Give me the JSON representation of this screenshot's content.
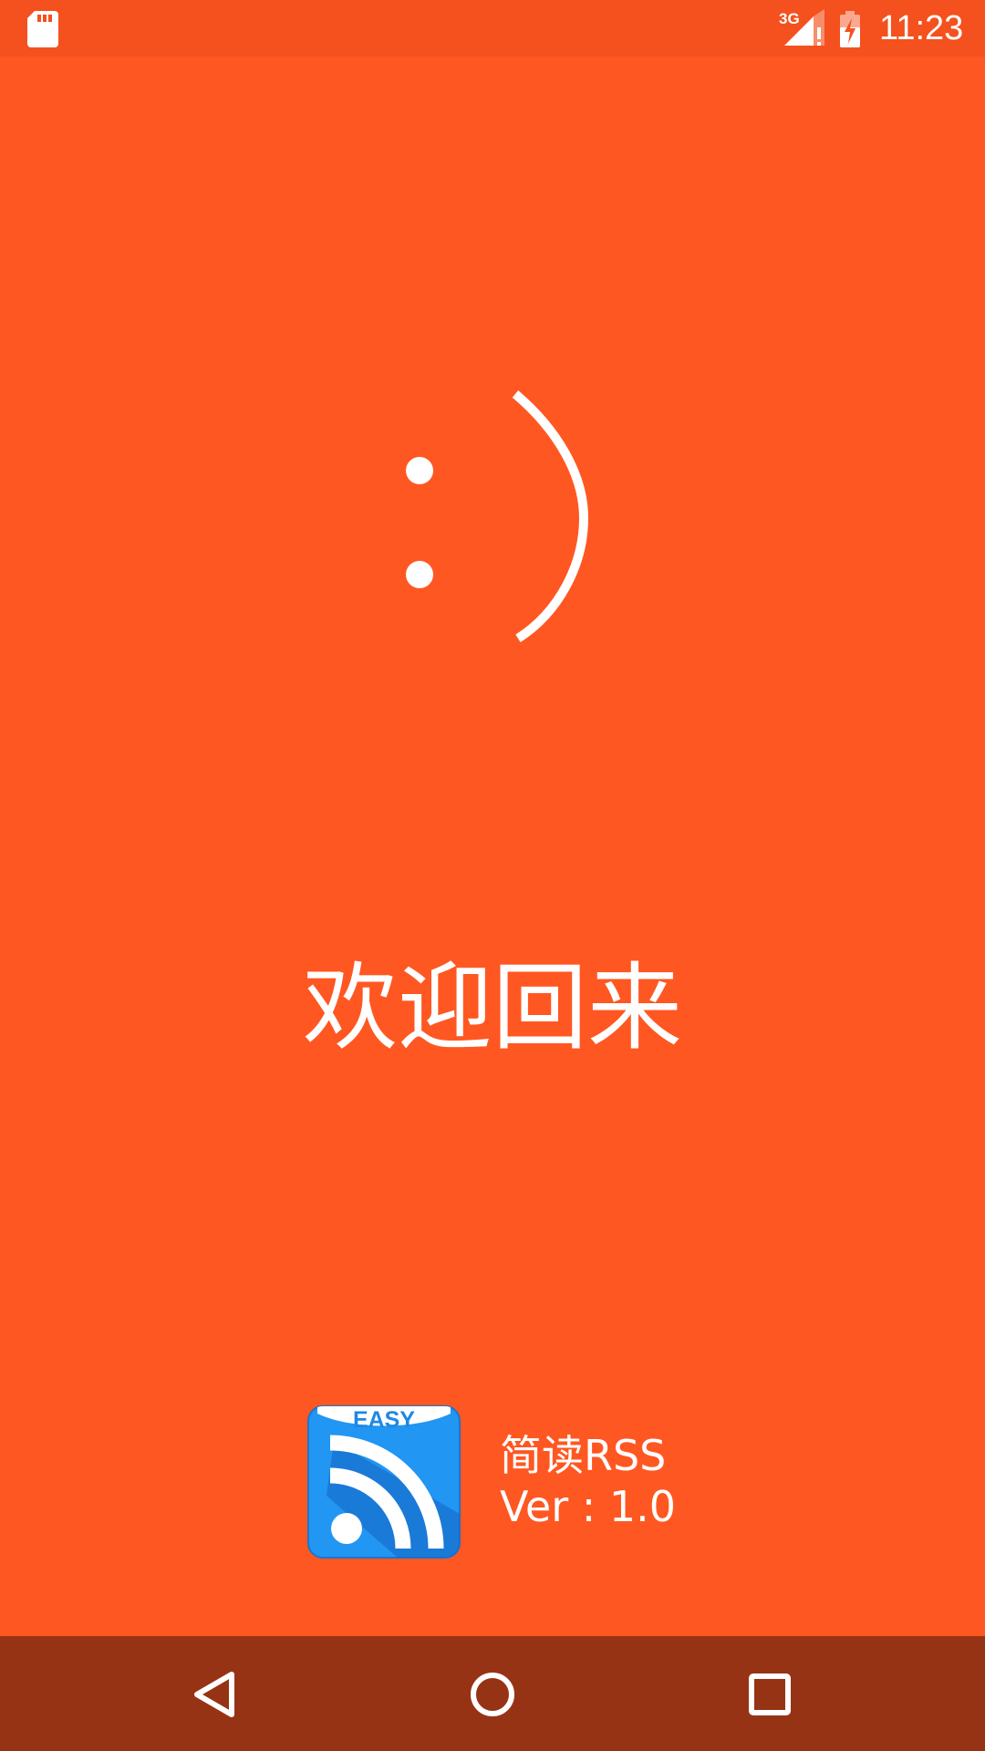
{
  "status_bar": {
    "network_label": "3G",
    "time": "11:23"
  },
  "splash": {
    "emoticon": ":)",
    "welcome_text": "欢迎回来"
  },
  "app": {
    "logo_text": "EASY",
    "name": "简读RSS",
    "version": "Ver : 1.0"
  },
  "colors": {
    "background": "#FF5722",
    "status_bar": "#F4511E",
    "nav_bar": "#973315",
    "logo_blue": "#2196F3",
    "logo_dark_blue": "#1565C0"
  },
  "icons": {
    "sd_card": "sd-card-icon",
    "signal": "signal-icon",
    "battery": "battery-charging-icon",
    "back": "back-icon",
    "home": "home-icon",
    "recents": "recents-icon"
  }
}
